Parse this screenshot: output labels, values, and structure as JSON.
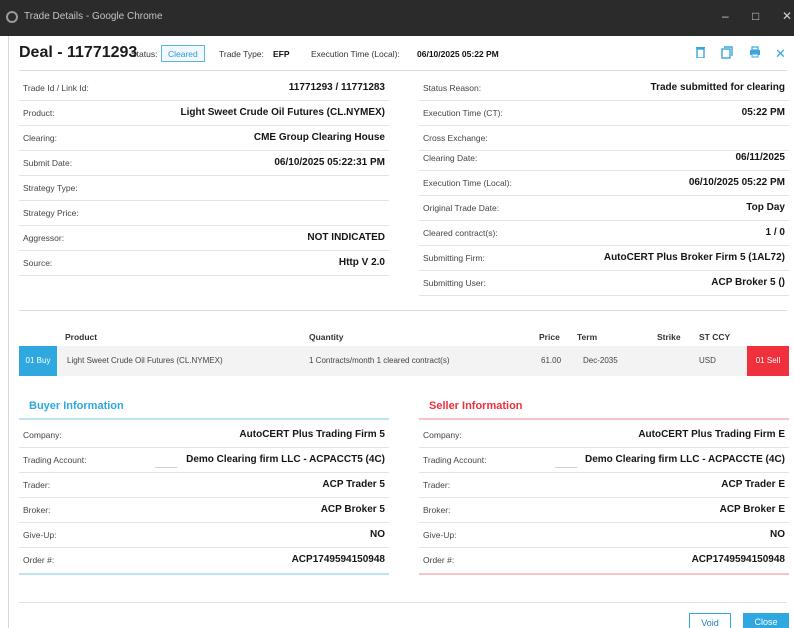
{
  "window": {
    "title": "Trade Details - Google Chrome",
    "minimize": "–",
    "maximize": "□",
    "close": "✕"
  },
  "header": {
    "deal_title": "Deal - 11771293",
    "status_label": "Status:",
    "status_value": "Cleared",
    "trade_type_label": "Trade Type:",
    "trade_type_value": "EFP",
    "exec_time_label": "Execution Time (Local):",
    "exec_time_value": "06/10/2025 05:22 PM",
    "icons": [
      "trash-icon",
      "copy-icon",
      "print-icon",
      "close-icon"
    ]
  },
  "left_fields": [
    {
      "label": "Trade Id / Link Id:",
      "value": "11771293 / 11771283"
    },
    {
      "label": "Product:",
      "value": "Light Sweet Crude Oil Futures (CL.NYMEX)"
    },
    {
      "label": "Clearing:",
      "value": "CME Group Clearing House"
    },
    {
      "label": "Submit Date:",
      "value": "06/10/2025 05:22:31 PM"
    },
    {
      "label": "Strategy Type:",
      "value": ""
    },
    {
      "label": "Strategy Price:",
      "value": ""
    },
    {
      "label": "Aggressor:",
      "value": "NOT INDICATED"
    },
    {
      "label": "Source:",
      "value": "Http V 2.0"
    }
  ],
  "right_fields": [
    {
      "label": "Status Reason:",
      "value": "Trade submitted for clearing"
    },
    {
      "label": "Execution Time (CT):",
      "value": "05:22 PM"
    },
    {
      "label": "Cross Exchange:",
      "value": ""
    },
    {
      "label": "Clearing Date:",
      "value": "06/11/2025"
    },
    {
      "label": "Execution Time (Local):",
      "value": "06/10/2025 05:22 PM"
    },
    {
      "label": "Original Trade Date:",
      "value": "Top Day"
    },
    {
      "label": "Cleared contract(s):",
      "value": "1 / 0"
    },
    {
      "label": "Submitting Firm:",
      "value": "AutoCERT Plus Broker Firm 5 (1AL72)"
    },
    {
      "label": "Submitting User:",
      "value": "ACP Broker 5 ()"
    }
  ],
  "product_table": {
    "headers": {
      "product": "Product",
      "quantity": "Quantity",
      "price": "Price",
      "term": "Term",
      "strike": "Strike",
      "st_ccy": "ST CCY"
    },
    "row": {
      "buy_tag": "01 Buy",
      "product": "Light Sweet Crude Oil Futures (CL.NYMEX)",
      "quantity": "1 Contracts/month 1 cleared contract(s)",
      "price": "61.00",
      "term": "Dec-2035",
      "strike": "",
      "st_ccy": "USD",
      "sell_tag": "01 Sell"
    }
  },
  "buyer": {
    "title": "Buyer Information",
    "fields": [
      {
        "label": "Company:",
        "value": "AutoCERT Plus Trading Firm 5"
      },
      {
        "label": "Trading Account:",
        "value": "Demo Clearing firm LLC - ACPACCT5 (4C)"
      },
      {
        "label": "Trader:",
        "value": "ACP Trader 5"
      },
      {
        "label": "Broker:",
        "value": "ACP Broker 5"
      },
      {
        "label": "Give-Up:",
        "value": "NO"
      },
      {
        "label": "Order #:",
        "value": "ACP1749594150948"
      }
    ]
  },
  "seller": {
    "title": "Seller Information",
    "fields": [
      {
        "label": "Company:",
        "value": "AutoCERT Plus Trading Firm E"
      },
      {
        "label": "Trading Account:",
        "value": "Demo Clearing firm LLC - ACPACCTE (4C)"
      },
      {
        "label": "Trader:",
        "value": "ACP Trader E"
      },
      {
        "label": "Broker:",
        "value": "ACP Broker E"
      },
      {
        "label": "Give-Up:",
        "value": "NO"
      },
      {
        "label": "Order #:",
        "value": "ACP1749594150948"
      }
    ]
  },
  "footer": {
    "void_label": "Void",
    "close_label": "Close"
  },
  "colors": {
    "accent_blue": "#2fa8e0",
    "sell_red": "#f0313d",
    "titlebar": "#2b2b2b"
  }
}
